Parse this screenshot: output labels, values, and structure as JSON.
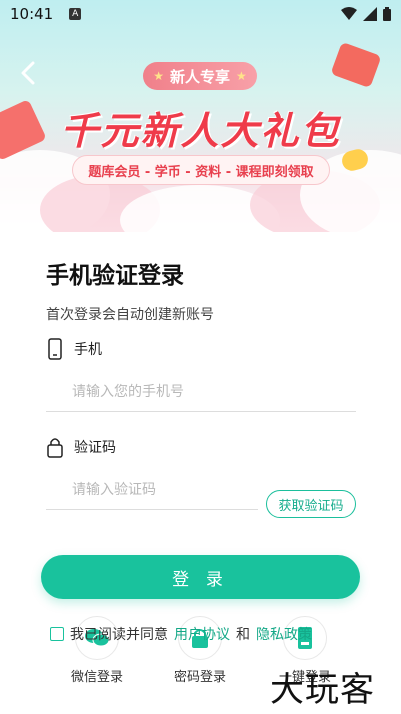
{
  "status_bar": {
    "time": "10:41",
    "notif": "A"
  },
  "banner": {
    "tag": "新人专享",
    "headline": "千元新人大礼包",
    "subtag": "题库会员 - 学币 - 资料 - 课程即刻领取"
  },
  "form": {
    "title": "手机验证登录",
    "hint": "首次登录会自动创建新账号",
    "phone_label": "手机",
    "phone_placeholder": "请输入您的手机号",
    "code_label": "验证码",
    "code_placeholder": "请输入验证码",
    "get_code": "获取验证码",
    "login": "登 录"
  },
  "agreement": {
    "prefix": "我已阅读并同意",
    "user_agreement": "用户协议",
    "and": "和",
    "privacy": "隐私政策"
  },
  "alt_login": {
    "wechat": "微信登录",
    "password": "密码登录",
    "onekey": "一键登录"
  },
  "watermark": "大玩客",
  "colors": {
    "accent": "#19c29d",
    "headline": "#ef3b4a"
  }
}
